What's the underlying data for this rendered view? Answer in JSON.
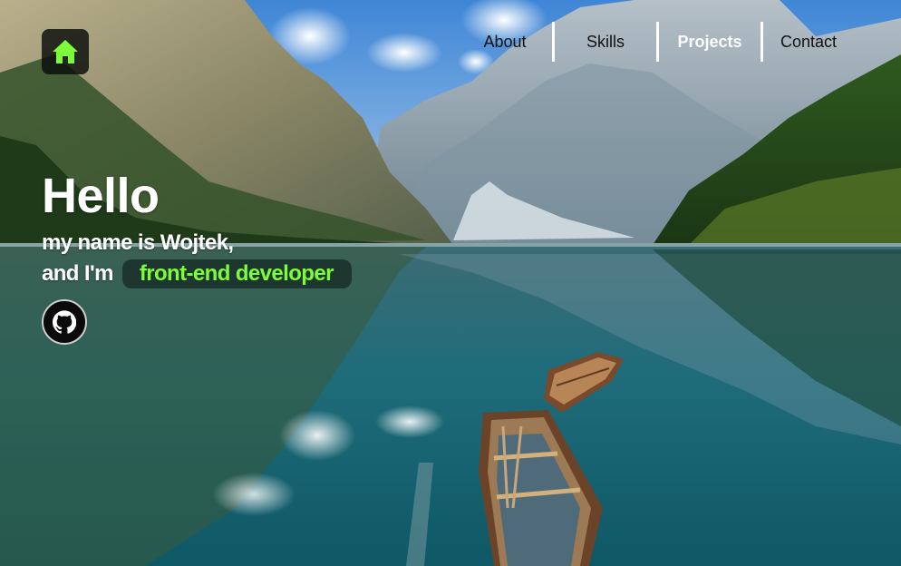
{
  "nav": {
    "home_icon": "home-icon",
    "items": [
      {
        "label": "About"
      },
      {
        "label": "Skills"
      },
      {
        "label": "Projects"
      },
      {
        "label": "Contact"
      }
    ],
    "active": "Projects"
  },
  "hero": {
    "greeting": "Hello",
    "line1": "my name is Wojtek,",
    "line2_prefix": "and I'm",
    "role": "front-end developer",
    "github_icon": "github-icon"
  },
  "colors": {
    "accent": "#7dfc3a",
    "nav_text": "#111111",
    "nav_active": "#ffffff"
  }
}
